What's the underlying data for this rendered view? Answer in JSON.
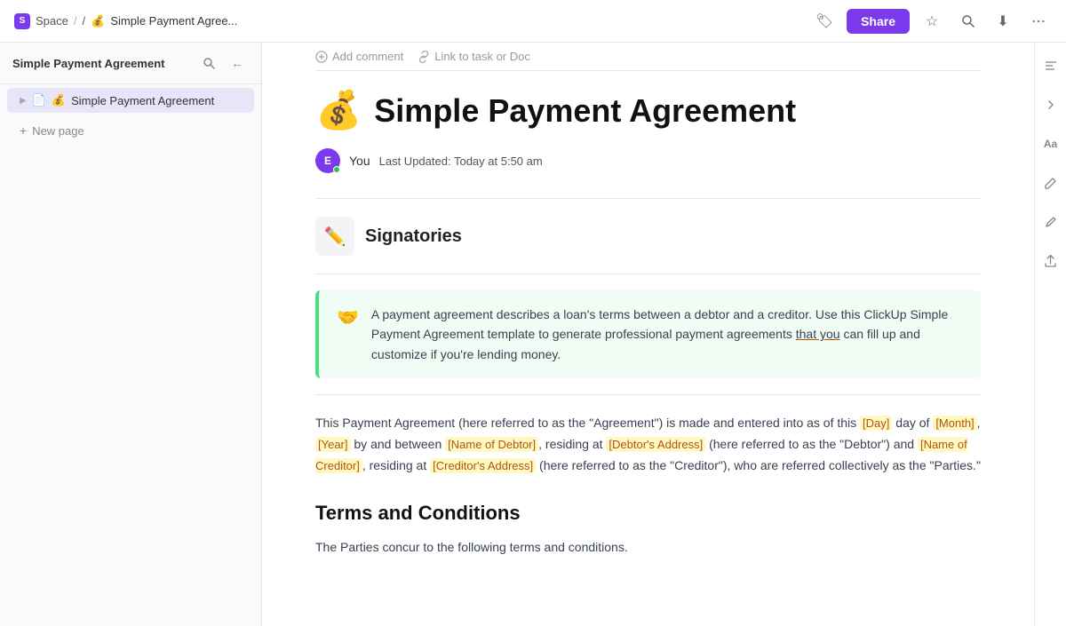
{
  "topbar": {
    "space_label": "Space",
    "breadcrumb_sep": "/",
    "page_icon": "💰",
    "page_title_crumb": "Simple Payment Agree...",
    "share_label": "Share",
    "icons": {
      "tag": "🏷",
      "star": "☆",
      "search": "🔍",
      "download": "⬇",
      "more": "⋯"
    }
  },
  "sidebar": {
    "title": "Simple Payment Agreement",
    "search_icon": "🔍",
    "collapse_icon": "←",
    "doc_item": {
      "chevron": "▶",
      "doc_icon": "📄",
      "emoji": "💰",
      "label": "Simple Payment Agreement"
    },
    "new_page_label": "New page"
  },
  "content": {
    "toolbar": {
      "add_comment": "Add comment",
      "link_task": "Link to task or Doc"
    },
    "title_emoji": "💰",
    "title": "Simple Payment Agreement",
    "author": {
      "initial": "E",
      "name": "You",
      "last_updated_label": "Last Updated:",
      "timestamp": "Today at 5:50 am"
    },
    "signatories": {
      "icon": "✏️",
      "heading": "Signatories"
    },
    "callout": {
      "emoji": "🤝",
      "text": "A payment agreement describes a loan's terms between a debtor and a creditor. Use this ClickUp Simple Payment Agreement template to generate professional payment agreements that you can fill up and customize if you're lending money."
    },
    "agreement_intro": "This Payment Agreement (here referred to as the \"Agreement\") is made and entered into as of this",
    "placeholders": {
      "day": "[Day]",
      "month": "[Month]",
      "year": "[Year]",
      "debtor_name": "[Name of Debtor]",
      "debtor_address": "[Debtor's Address]",
      "creditor_name": "[Name of Creditor]",
      "creditor_address": "[Creditor's Address]"
    },
    "agreement_mid": "day of",
    "agreement_by": "by and between",
    "agreement_residing": "residing at",
    "agreement_debtor_ref": "(here referred to as the \"Debtor\") and",
    "agreement_creditor_ref": "residing at",
    "agreement_creditor_end": "(here referred to as the \"Creditor\"), who are referred collectively as the \"Parties.\"",
    "terms_heading": "Terms and Conditions",
    "terms_text": "The Parties concur to the following terms and conditions."
  },
  "right_toolbar": {
    "list_icon": "≡",
    "collapse_icon": "→",
    "font_icon": "Aa",
    "pen_icon": "✏",
    "pen2_icon": "✒",
    "share_icon": "↑"
  }
}
